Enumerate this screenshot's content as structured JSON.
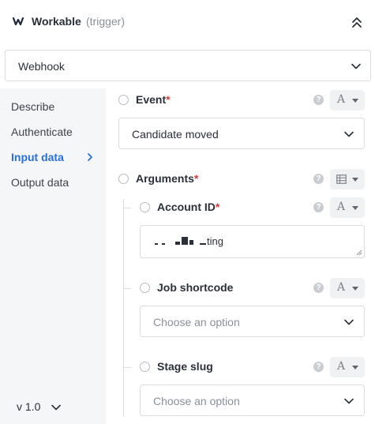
{
  "header": {
    "app_name": "Workable",
    "trigger_tag": "(trigger)",
    "logo_icon": "workable-logo-icon",
    "collapse_icon": "double-chevron-up-icon"
  },
  "webhook_select": {
    "value": "Webhook",
    "icon": "chevron-down-icon"
  },
  "sidebar": {
    "items": [
      {
        "label": "Describe",
        "active": false
      },
      {
        "label": "Authenticate",
        "active": false
      },
      {
        "label": "Input data",
        "active": true
      },
      {
        "label": "Output data",
        "active": false
      }
    ],
    "version": "v 1.0"
  },
  "fields": {
    "event": {
      "label": "Event",
      "required_mark": "*",
      "help": "?",
      "type_glyph": "A",
      "value": "Candidate moved"
    },
    "arguments": {
      "label": "Arguments",
      "required_mark": "*",
      "help": "?",
      "type_icon": "table-icon"
    },
    "account_id": {
      "label": "Account ID",
      "required_mark": "*",
      "help": "?",
      "type_glyph": "A",
      "value": "ting"
    },
    "job_shortcode": {
      "label": "Job shortcode",
      "help": "?",
      "type_glyph": "A",
      "placeholder": "Choose an option"
    },
    "stage_slug": {
      "label": "Stage slug",
      "help": "?",
      "type_glyph": "A",
      "placeholder": "Choose an option"
    }
  },
  "colors": {
    "accent": "#2a6fd6",
    "required": "#d33d3d",
    "sidebar_bg": "#f5f6f7",
    "border": "#d9dce1"
  }
}
